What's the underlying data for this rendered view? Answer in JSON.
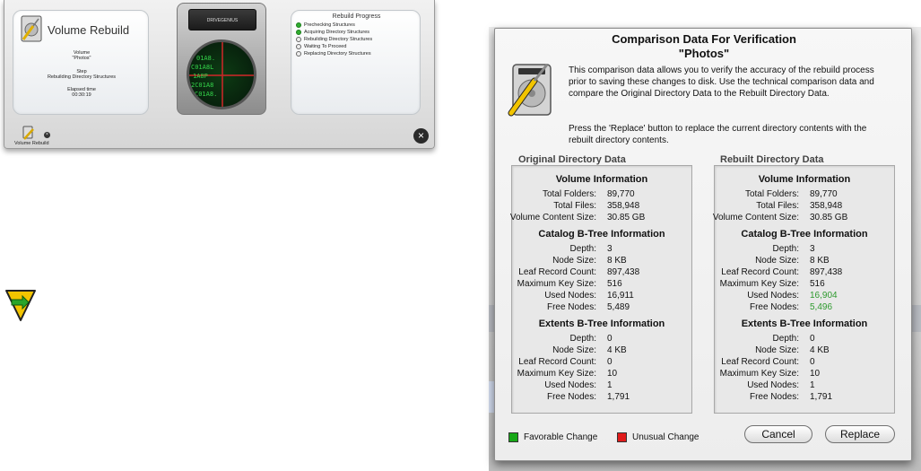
{
  "volume_rebuild": {
    "title": "Volume Rebuild",
    "volume_label": "Volume",
    "volume_value": "\"Photos\"",
    "step_label": "Step",
    "step_value": "Rebuilding Directory Structures",
    "elapsed_label": "Elapsed time",
    "elapsed_value": "00:30:19",
    "drive_brand": "DRIVEGENIUS",
    "scope_text": [
      "01A8.",
      "C01A8L",
      "1A8P",
      "2C01A8",
      "C01A8."
    ],
    "bottom_label": "Volume Rebuild",
    "progress": {
      "title": "Rebuild Progress",
      "steps": [
        {
          "label": "Prechecking Structures",
          "done": true
        },
        {
          "label": "Acquiring Directory Structures",
          "done": true
        },
        {
          "label": "Rebuilding Directory Structures",
          "done": false
        },
        {
          "label": "Waiting To Proceed",
          "done": false
        },
        {
          "label": "Replacing Directory Structures",
          "done": false
        }
      ]
    }
  },
  "dialog": {
    "title": "Comparison Data For Verification",
    "subtitle": "\"Photos\"",
    "description": "This comparison data allows you to verify the accuracy of the rebuild process prior to saving these changes to disk. Use the technical comparison data and compare the Original Directory Data to the Rebuilt Directory Data.",
    "press_text": "Press the 'Replace' button to replace the current directory contents with the rebuilt directory contents.",
    "original": {
      "title": "Original Directory Data",
      "volume_title": "Volume Information",
      "volume_rows": [
        {
          "label": "Total Folders:",
          "value": "89,770"
        },
        {
          "label": "Total Files:",
          "value": "358,948"
        },
        {
          "label": "Volume Content Size:",
          "value": "30.85 GB"
        }
      ],
      "catalog_title": "Catalog B-Tree Information",
      "catalog_rows": [
        {
          "label": "Depth:",
          "value": "3"
        },
        {
          "label": "Node Size:",
          "value": "8 KB"
        },
        {
          "label": "Leaf Record Count:",
          "value": "897,438"
        },
        {
          "label": "Maximum Key Size:",
          "value": "516"
        },
        {
          "label": "Used Nodes:",
          "value": "16,911"
        },
        {
          "label": "Free Nodes:",
          "value": "5,489"
        }
      ],
      "extents_title": "Extents B-Tree Information",
      "extents_rows": [
        {
          "label": "Depth:",
          "value": "0"
        },
        {
          "label": "Node Size:",
          "value": "4 KB"
        },
        {
          "label": "Leaf Record Count:",
          "value": "0"
        },
        {
          "label": "Maximum Key Size:",
          "value": "10"
        },
        {
          "label": "Used Nodes:",
          "value": "1"
        },
        {
          "label": "Free Nodes:",
          "value": "1,791"
        }
      ]
    },
    "rebuilt": {
      "title": "Rebuilt Directory Data",
      "volume_title": "Volume Information",
      "volume_rows": [
        {
          "label": "Total Folders:",
          "value": "89,770"
        },
        {
          "label": "Total Files:",
          "value": "358,948"
        },
        {
          "label": "Volume Content Size:",
          "value": "30.85 GB"
        }
      ],
      "catalog_title": "Catalog B-Tree Information",
      "catalog_rows": [
        {
          "label": "Depth:",
          "value": "3"
        },
        {
          "label": "Node Size:",
          "value": "8 KB"
        },
        {
          "label": "Leaf Record Count:",
          "value": "897,438"
        },
        {
          "label": "Maximum Key Size:",
          "value": "516"
        },
        {
          "label": "Used Nodes:",
          "value": "16,904",
          "favorable": true
        },
        {
          "label": "Free Nodes:",
          "value": "5,496",
          "favorable": true
        }
      ],
      "extents_title": "Extents B-Tree Information",
      "extents_rows": [
        {
          "label": "Depth:",
          "value": "0"
        },
        {
          "label": "Node Size:",
          "value": "4 KB"
        },
        {
          "label": "Leaf Record Count:",
          "value": "0"
        },
        {
          "label": "Maximum Key Size:",
          "value": "10"
        },
        {
          "label": "Used Nodes:",
          "value": "1"
        },
        {
          "label": "Free Nodes:",
          "value": "1,791"
        }
      ]
    },
    "legend": {
      "favorable_label": "Favorable Change",
      "favorable_color": "#17a817",
      "unusual_label": "Unusual Change",
      "unusual_color": "#e01b1b"
    },
    "buttons": {
      "cancel": "Cancel",
      "replace": "Replace"
    }
  }
}
